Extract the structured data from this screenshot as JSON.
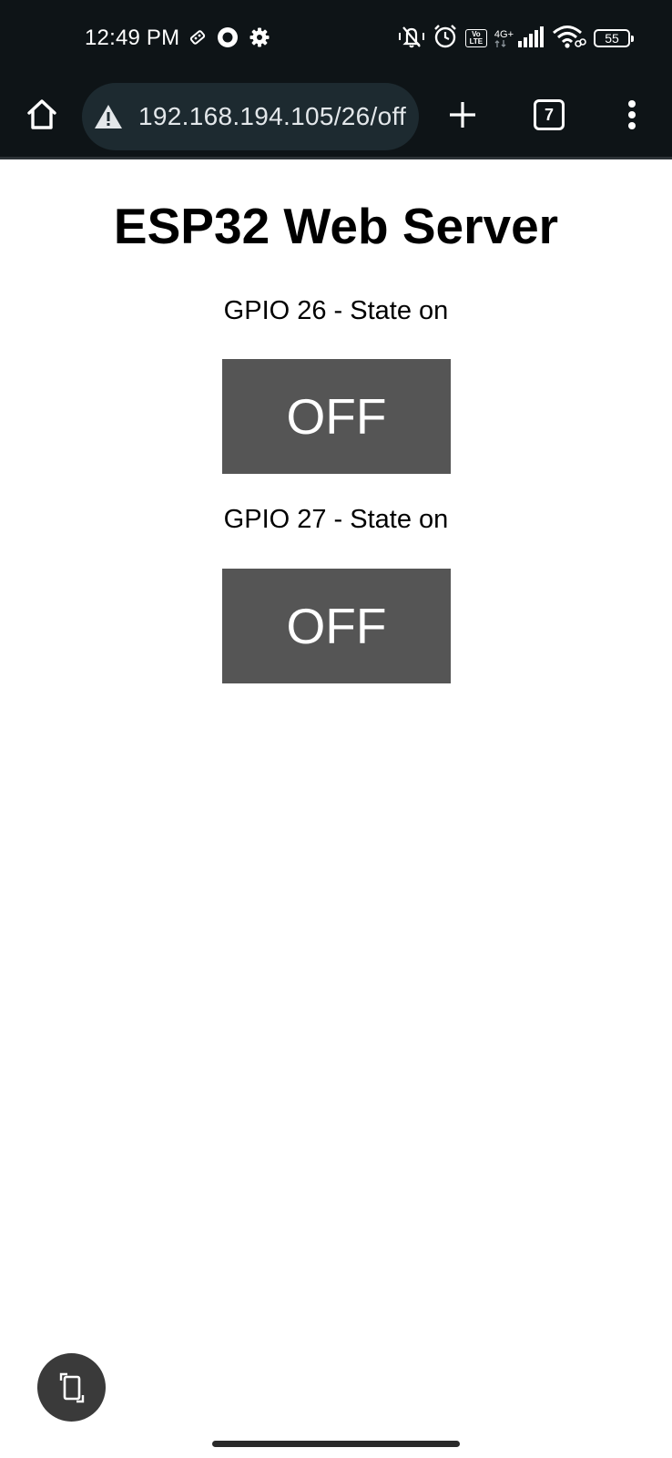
{
  "status_bar": {
    "time": "12:49 PM",
    "left_icons": [
      "bluetooth-hardware-icon",
      "circle-record-icon",
      "gear-icon"
    ],
    "right_icons": [
      "vibrate-mute-icon",
      "alarm-icon",
      "volte-icon",
      "cellular-signal-icon",
      "wifi-icon",
      "battery-icon"
    ],
    "volte_top": "Vo",
    "volte_bottom": "LTE",
    "network_type": "4G+",
    "battery_level": "55"
  },
  "browser": {
    "url": "192.168.194.105/26/off",
    "security_icon": "warning-triangle-icon",
    "tab_count": "7"
  },
  "page": {
    "title": "ESP32 Web Server",
    "gpio26": {
      "label": "GPIO 26 - State on",
      "button_label": "OFF"
    },
    "gpio27": {
      "label": "GPIO 27 - State on",
      "button_label": "OFF"
    },
    "button_color": "#555555"
  },
  "colors": {
    "status_bar_bg": "#0e1417",
    "omnibox_bg": "#1d2a30",
    "page_bg": "#ffffff"
  }
}
